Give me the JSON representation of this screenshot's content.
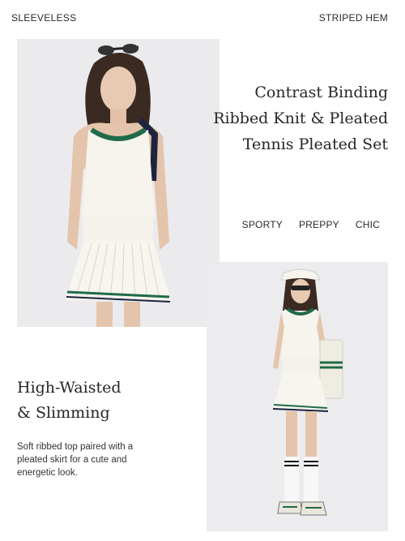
{
  "top_labels": {
    "left": "SLEEVELESS",
    "right": "STRIPED HEM"
  },
  "title_lines": [
    "Contrast Binding",
    "Ribbed Knit & Pleated",
    "Tennis Pleated Set"
  ],
  "tags": [
    "SPORTY",
    "PREPPY",
    "CHIC"
  ],
  "heading_lines": [
    "High-Waisted",
    "& Slimming"
  ],
  "description": "Soft ribbed top paired with a pleated skirt for a cute and energetic look.",
  "colors": {
    "trim_green": "#1f6b4a",
    "trim_navy": "#1c2440",
    "garment_white": "#f6f4ec",
    "photo_bg": "#ebebee"
  }
}
